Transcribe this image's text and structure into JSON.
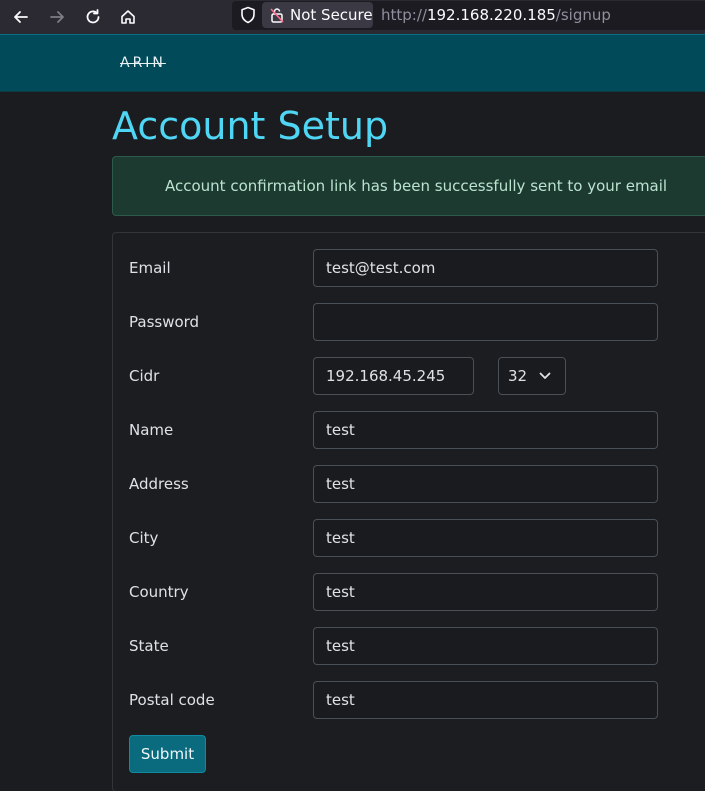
{
  "browser": {
    "security_label": "Not Secure",
    "url_scheme": "http://",
    "url_host": "192.168.220.185",
    "url_path": "/signup"
  },
  "header": {
    "brand": "ARIN"
  },
  "page": {
    "title": "Account Setup",
    "alert": "Account confirmation link has been successfully sent to your email"
  },
  "form": {
    "email": {
      "label": "Email",
      "value": "test@test.com"
    },
    "password": {
      "label": "Password",
      "value": ""
    },
    "cidr": {
      "label": "Cidr",
      "value": "192.168.45.245",
      "prefix": "32"
    },
    "name": {
      "label": "Name",
      "value": "test"
    },
    "address": {
      "label": "Address",
      "value": "test"
    },
    "city": {
      "label": "City",
      "value": "test"
    },
    "country": {
      "label": "Country",
      "value": "test"
    },
    "state": {
      "label": "State",
      "value": "test"
    },
    "postal_code": {
      "label": "Postal code",
      "value": "test"
    },
    "submit_label": "Submit"
  },
  "colors": {
    "accent": "#4fd6f5",
    "header_bg": "#004a5a",
    "button_bg": "#0a6b7f",
    "alert_bg": "#1d3a31"
  }
}
